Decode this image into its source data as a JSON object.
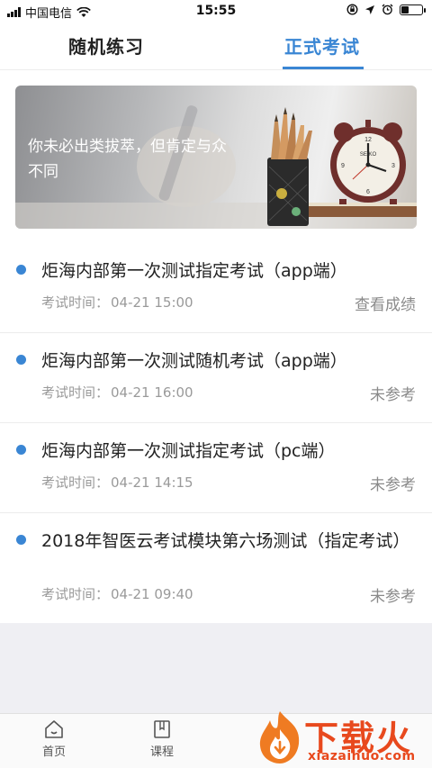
{
  "status_bar": {
    "carrier": "中国电信",
    "time": "15:55",
    "battery_level": 0.35,
    "icons": [
      "signal-icon",
      "wifi-icon",
      "lock-rotation-icon",
      "location-icon",
      "alarm-icon",
      "battery-icon"
    ]
  },
  "tabs": [
    {
      "label": "随机练习",
      "active": false
    },
    {
      "label": "正式考试",
      "active": true
    }
  ],
  "banner": {
    "text": "你未必出类拔萃，但肯定与众不同",
    "clock_brand": "SEIKO"
  },
  "exams": [
    {
      "title": "炬海内部第一次测试指定考试（app端）",
      "time_label": "考试时间：",
      "time": "04-21 15:00",
      "status": "查看成绩"
    },
    {
      "title": "炬海内部第一次测试随机考试（app端）",
      "time_label": "考试时间：",
      "time": "04-21 16:00",
      "status": "未参考"
    },
    {
      "title": "炬海内部第一次测试指定考试（pc端）",
      "time_label": "考试时间：",
      "time": "04-21 14:15",
      "status": "未参考"
    },
    {
      "title": "2018年智医云考试模块第六场测试（指定考试）",
      "time_label": "考试时间：",
      "time": "04-21 09:40",
      "status": "未参考"
    }
  ],
  "bottom_nav": [
    {
      "label": "首页",
      "icon": "home-icon"
    },
    {
      "label": "课程",
      "icon": "book-icon"
    }
  ],
  "watermark": {
    "text": "下载火",
    "url": "xiazaihuo.com"
  },
  "colors": {
    "accent": "#3a86d4",
    "watermark": "#e8491d",
    "background_gray": "#efeff3"
  }
}
